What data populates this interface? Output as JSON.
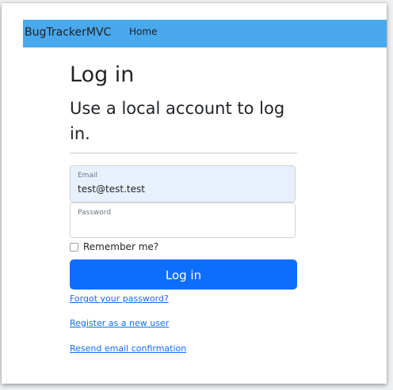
{
  "navbar": {
    "brand": "BugTrackerMVC",
    "home": "Home",
    "background": "#4aa8ec"
  },
  "page": {
    "title": "Log in",
    "subtitle": "Use a local account to log in."
  },
  "form": {
    "email": {
      "label": "Email",
      "value": "test@test.test"
    },
    "password": {
      "label": "Password",
      "value": ""
    },
    "remember_label": "Remember me?",
    "remember_checked": false,
    "submit_label": "Log in",
    "submit_color": "#0d6efd"
  },
  "links": {
    "forgot": "Forgot your password?",
    "register": "Register as a new user",
    "resend": "Resend email confirmation"
  }
}
